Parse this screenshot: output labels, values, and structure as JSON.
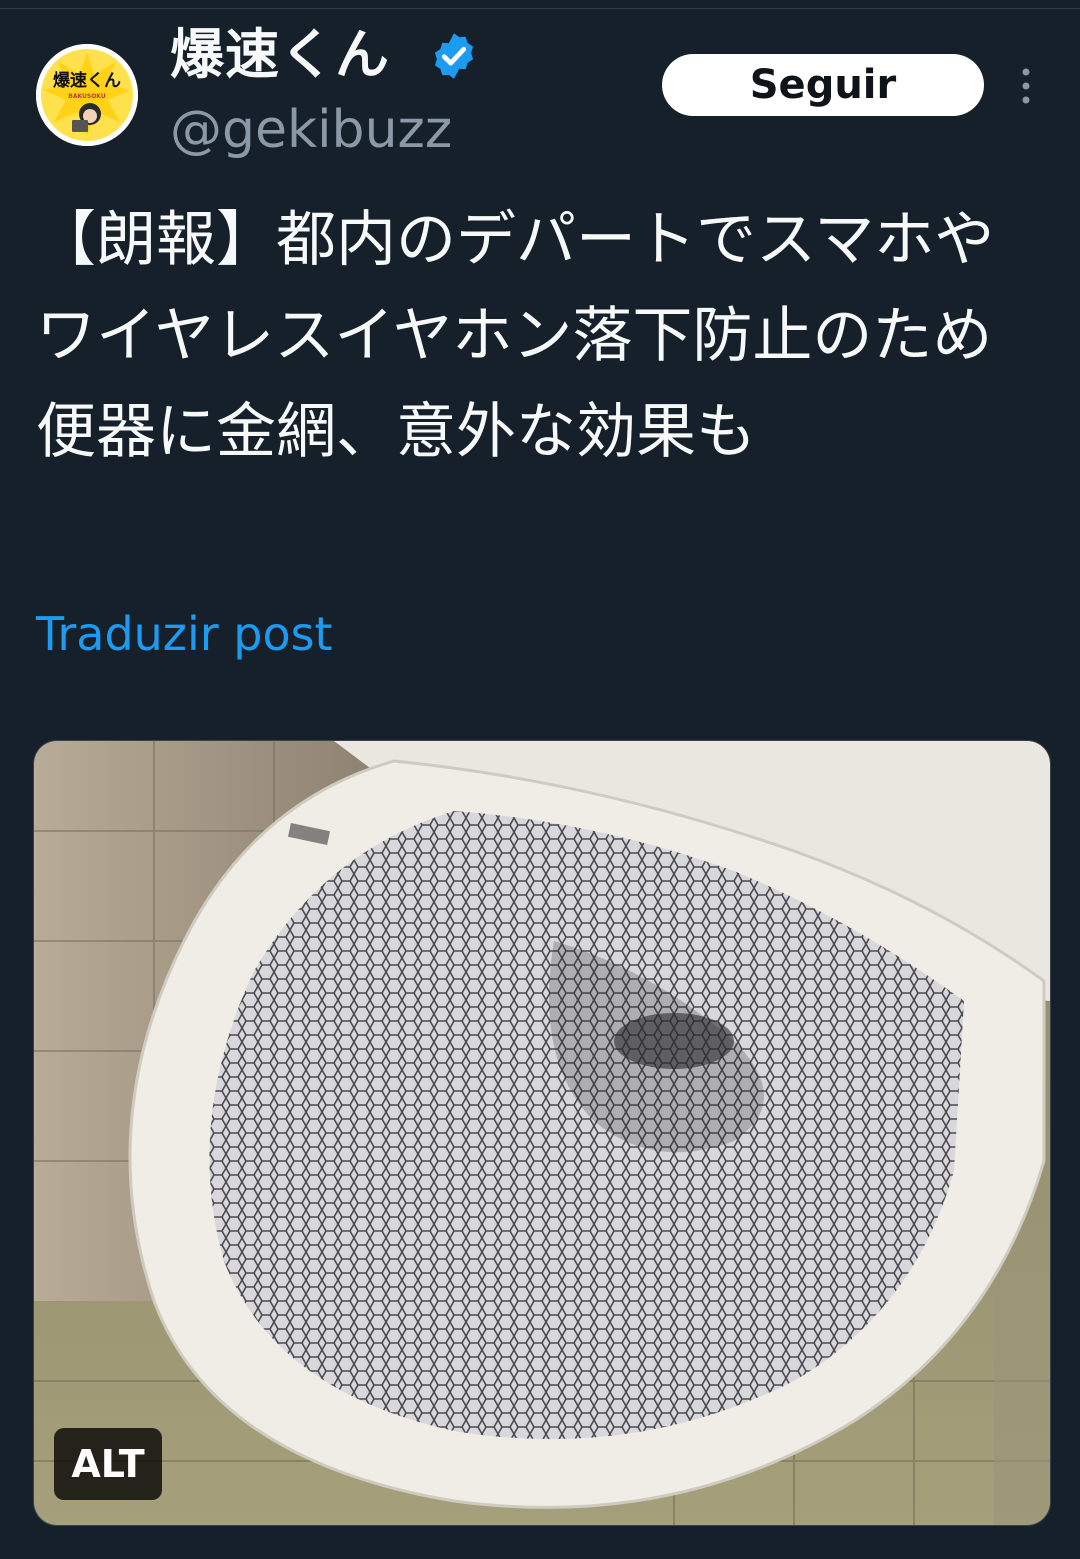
{
  "author": {
    "display_name": "爆速くん",
    "handle": "@gekibuzz",
    "avatar_text": "爆速くん",
    "avatar_subtext": "BAKUSOKU",
    "verified": true
  },
  "header": {
    "follow_label": "Seguir",
    "more_icon": "more-vertical-icon"
  },
  "post": {
    "text": "【朗報】都内のデパートでスマホやワイヤレスイヤホン落下防止のため便器に金網、意外な効果も",
    "translate_label": "Traduzir post"
  },
  "media": {
    "alt_label": "ALT"
  },
  "colors": {
    "background": "#15202b",
    "link": "#1d9bf0",
    "verified": "#1d9bf0",
    "handle": "#8b98a5"
  }
}
